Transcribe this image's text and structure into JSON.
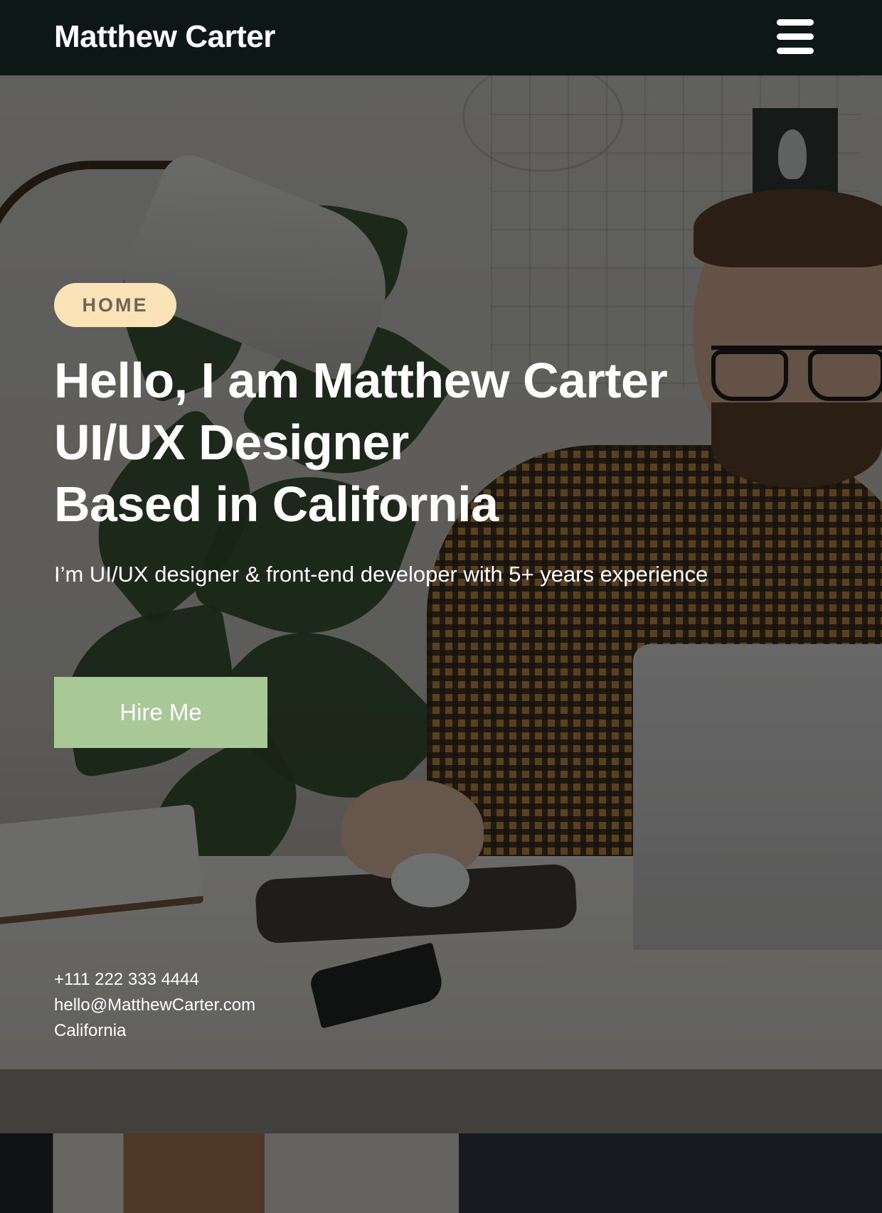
{
  "header": {
    "brand": "Matthew Carter",
    "menu_icon": "hamburger-menu-icon"
  },
  "hero": {
    "badge": "HOME",
    "headline": [
      "Hello, I am Matthew Carter",
      "UI/UX Designer",
      "Based in California"
    ],
    "subtitle": "I’m UI/UX designer & front-end developer with 5+ years experience",
    "cta_label": "Hire Me",
    "background_image": "person-working-at-desk-photo"
  },
  "contact": {
    "phone": "+111 222 333 4444",
    "email": "hello@MatthewCarter.com",
    "location": "California"
  },
  "colors": {
    "header_bg": "#0c1716",
    "badge_bg": "#fbe3b8",
    "badge_text": "#6e6656",
    "cta_bg": "#a8c896",
    "text": "#ffffff"
  }
}
